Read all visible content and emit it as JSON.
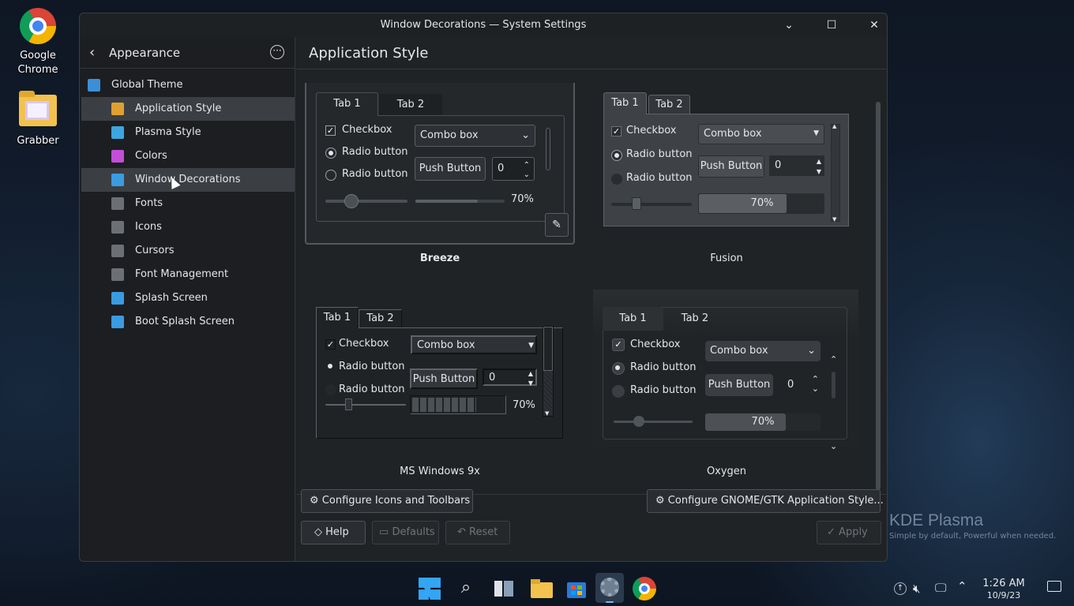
{
  "desktop": {
    "icons": [
      {
        "label": "Google\nChrome"
      },
      {
        "label": "Grabber"
      }
    ],
    "watermark": {
      "brand": "KDE Plasma",
      "tagline": "Simple by default, Powerful when  needed."
    }
  },
  "window": {
    "title": "Window Decorations — System Settings",
    "controls": {
      "minimize": "⌄",
      "maximize": "☐",
      "close": "✕"
    }
  },
  "sidebar": {
    "back_label": "Appearance",
    "items": [
      {
        "label": "Global Theme",
        "icon": "global-theme-icon",
        "indent": false,
        "selected": false
      },
      {
        "label": "Application Style",
        "icon": "application-style-icon",
        "indent": true,
        "selected": true
      },
      {
        "label": "Plasma Style",
        "icon": "plasma-style-icon",
        "indent": true,
        "selected": false
      },
      {
        "label": "Colors",
        "icon": "colors-icon",
        "indent": true,
        "selected": false
      },
      {
        "label": "Window Decorations",
        "icon": "window-decorations-icon",
        "indent": true,
        "selected": false,
        "hovered": true
      },
      {
        "label": "Fonts",
        "icon": "fonts-icon",
        "indent": true,
        "selected": false
      },
      {
        "label": "Icons",
        "icon": "icons-icon",
        "indent": true,
        "selected": false
      },
      {
        "label": "Cursors",
        "icon": "cursors-icon",
        "indent": true,
        "selected": false
      },
      {
        "label": "Font Management",
        "icon": "font-management-icon",
        "indent": true,
        "selected": false
      },
      {
        "label": "Splash Screen",
        "icon": "splash-screen-icon",
        "indent": true,
        "selected": false
      },
      {
        "label": "Boot Splash Screen",
        "icon": "boot-splash-icon",
        "indent": true,
        "selected": false
      }
    ]
  },
  "main": {
    "title": "Application Style",
    "styles": [
      {
        "name": "Breeze",
        "selected": true,
        "tab1": "Tab 1",
        "tab2": "Tab 2",
        "checkbox": "Checkbox",
        "radio1": "Radio button",
        "radio2": "Radio button",
        "combo": "Combo box",
        "push": "Push Button",
        "spin": "0",
        "progress_text": "70%",
        "progress": 0.7
      },
      {
        "name": "Fusion",
        "selected": false,
        "tab1": "Tab 1",
        "tab2": "Tab 2",
        "checkbox": "Checkbox",
        "radio1": "Radio button",
        "radio2": "Radio button",
        "combo": "Combo box",
        "push": "Push Button",
        "spin": "0",
        "progress_text": "70%",
        "progress": 0.7
      },
      {
        "name": "MS Windows 9x",
        "selected": false,
        "tab1": "Tab 1",
        "tab2": "Tab 2",
        "checkbox": "Checkbox",
        "radio1": "Radio button",
        "radio2": "Radio button",
        "combo": "Combo box",
        "push": "Push Button",
        "spin": "0",
        "progress_text": "70%",
        "progress": 0.7
      },
      {
        "name": "Oxygen",
        "selected": false,
        "tab1": "Tab 1",
        "tab2": "Tab 2",
        "checkbox": "Checkbox",
        "radio1": "Radio button",
        "radio2": "Radio button",
        "combo": "Combo box",
        "push": "Push Button",
        "spin": "0",
        "progress_text": "70%",
        "progress": 0.7
      }
    ],
    "edit_icon": "pencil-icon"
  },
  "footer": {
    "configure_icons": "Configure Icons and Toolbars",
    "configure_gtk": "Configure GNOME/GTK Application Style...",
    "help": "Help",
    "defaults": "Defaults",
    "reset": "Reset",
    "apply": "Apply"
  },
  "taskbar": {
    "apps": [
      "start-icon",
      "search-icon",
      "task-view-icon",
      "file-explorer-icon",
      "store-icon",
      "system-settings-icon",
      "chrome-icon"
    ],
    "time": "1:26 AM",
    "date": "10/9/23"
  },
  "colors": {
    "accent": "#3daee9",
    "window_bg": "#202326",
    "sidebar_bg": "#1c1e21",
    "selection": "#3b3f43"
  }
}
